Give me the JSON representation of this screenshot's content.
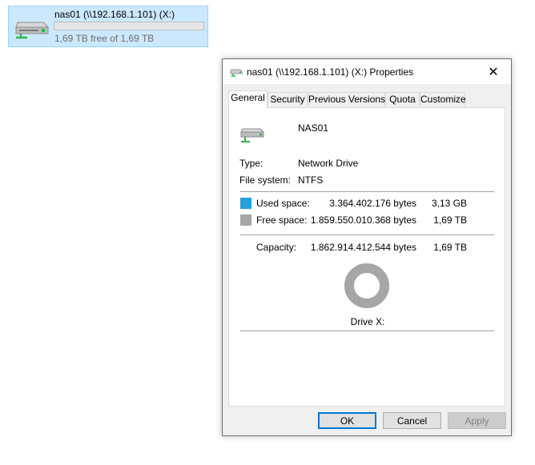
{
  "explorer_tile": {
    "drive_name": "nas01 (\\\\192.168.1.101) (X:)",
    "free_text": "1,69 TB free of 1,69 TB",
    "used_fraction": 0.0,
    "icon": "network-drive-icon"
  },
  "dialog": {
    "title": "nas01 (\\\\192.168.1.101) (X:) Properties",
    "close_glyph": "✕",
    "tabs": [
      "General",
      "Security",
      "Previous Versions",
      "Quota",
      "Customize"
    ],
    "active_tab": "General",
    "general": {
      "drive_label": "NAS01",
      "type_label": "Type:",
      "type_value": "Network Drive",
      "fs_label": "File system:",
      "fs_value": "NTFS",
      "used_label": "Used space:",
      "used_bytes": "3.364.402.176 bytes",
      "used_size": "3,13 GB",
      "free_label": "Free space:",
      "free_bytes": "1.859.550.010.368 bytes",
      "free_size": "1,69 TB",
      "capacity_label": "Capacity:",
      "capacity_bytes": "1.862.914.412.544 bytes",
      "capacity_size": "1,69 TB",
      "drive_caption": "Drive X:",
      "used_color": "#26a0da",
      "free_color": "#a6a6a6"
    },
    "buttons": {
      "ok": "OK",
      "cancel": "Cancel",
      "apply": "Apply"
    }
  }
}
